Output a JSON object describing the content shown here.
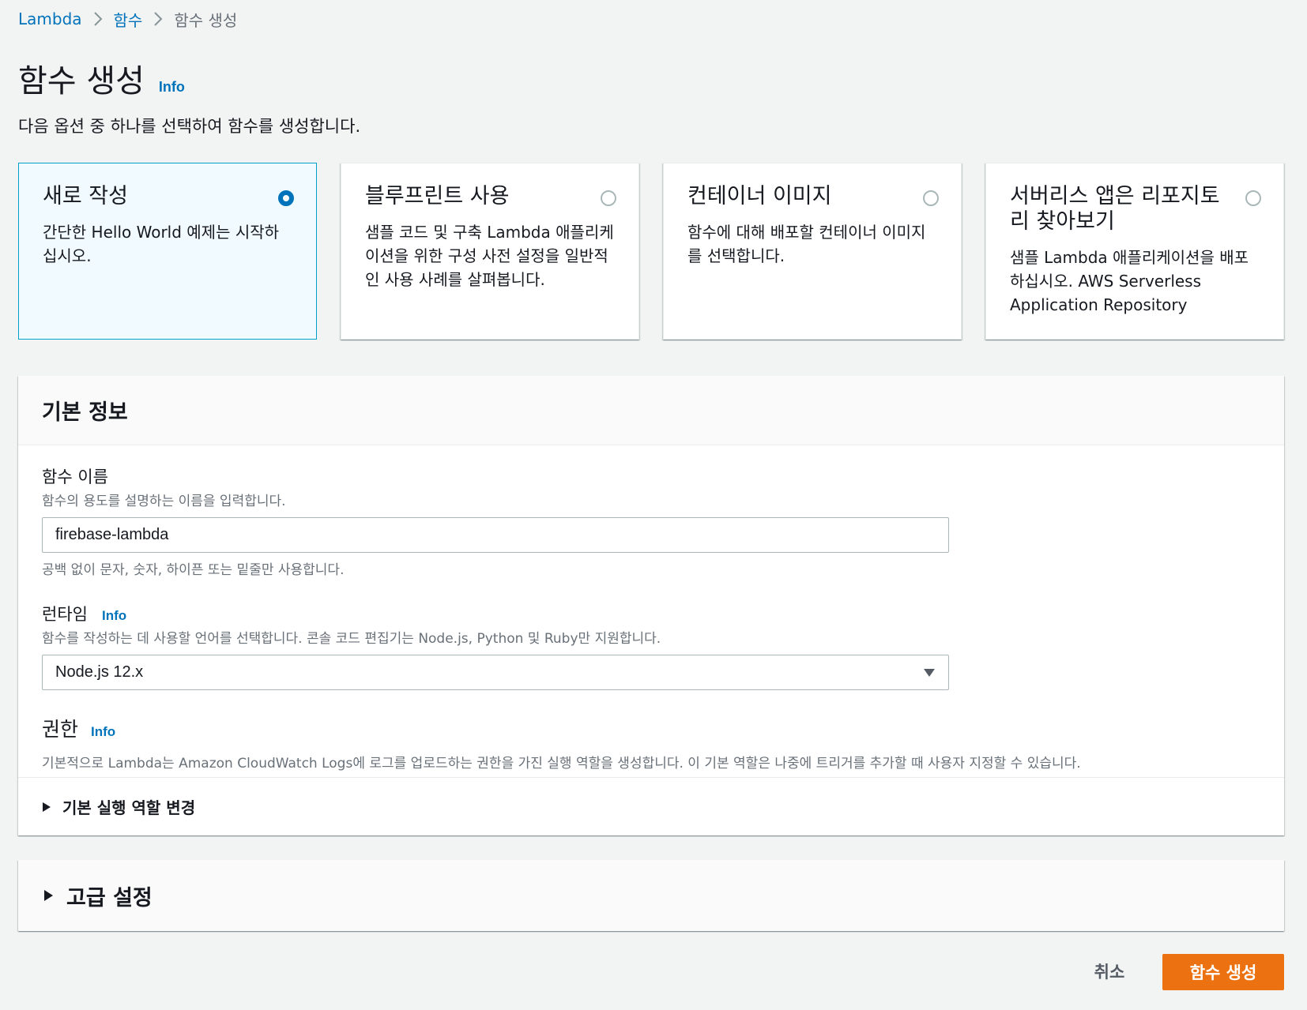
{
  "breadcrumb": {
    "items": [
      "Lambda",
      "함수",
      "함수 생성"
    ]
  },
  "header": {
    "title": "함수 생성",
    "info": "Info",
    "subtitle": "다음 옵션 중 하나를 선택하여 함수를 생성합니다."
  },
  "options": [
    {
      "title": "새로 작성",
      "desc": "간단한 Hello World 예제는 시작하십시오.",
      "selected": true
    },
    {
      "title": "블루프린트 사용",
      "desc": "샘플 코드 및 구축 Lambda 애플리케이션을 위한 구성 사전 설정을 일반적인 사용 사례를 살펴봅니다.",
      "selected": false
    },
    {
      "title": "컨테이너 이미지",
      "desc": "함수에 대해 배포할 컨테이너 이미지를 선택합니다.",
      "selected": false
    },
    {
      "title": "서버리스 앱은 리포지토리 찾아보기",
      "desc": "샘플 Lambda 애플리케이션을 배포하십시오. AWS Serverless Application Repository",
      "selected": false
    }
  ],
  "basic": {
    "header": "기본 정보",
    "function_name": {
      "label": "함수 이름",
      "desc": "함수의 용도를 설명하는 이름을 입력합니다.",
      "value": "firebase-lambda",
      "constraint": "공백 없이 문자, 숫자, 하이픈 또는 밑줄만 사용합니다."
    },
    "runtime": {
      "label": "런타임",
      "info": "Info",
      "desc": "함수를 작성하는 데 사용할 언어를 선택합니다. 콘솔 코드 편집기는 Node.js, Python 및 Ruby만 지원합니다.",
      "value": "Node.js 12.x"
    },
    "permissions": {
      "label": "권한",
      "info": "Info",
      "desc": "기본적으로 Lambda는 Amazon CloudWatch Logs에 로그를 업로드하는 권한을 가진 실행 역할을 생성합니다. 이 기본 역할은 나중에 트리거를 추가할 때 사용자 지정할 수 있습니다."
    },
    "expander": "기본 실행 역할 변경"
  },
  "advanced": {
    "label": "고급 설정"
  },
  "footer": {
    "cancel": "취소",
    "create": "함수 생성"
  },
  "colors": {
    "link": "#0073bb",
    "primary": "#ec7211",
    "selected_bg": "#f1faff",
    "selected_border": "#00a1c9"
  }
}
